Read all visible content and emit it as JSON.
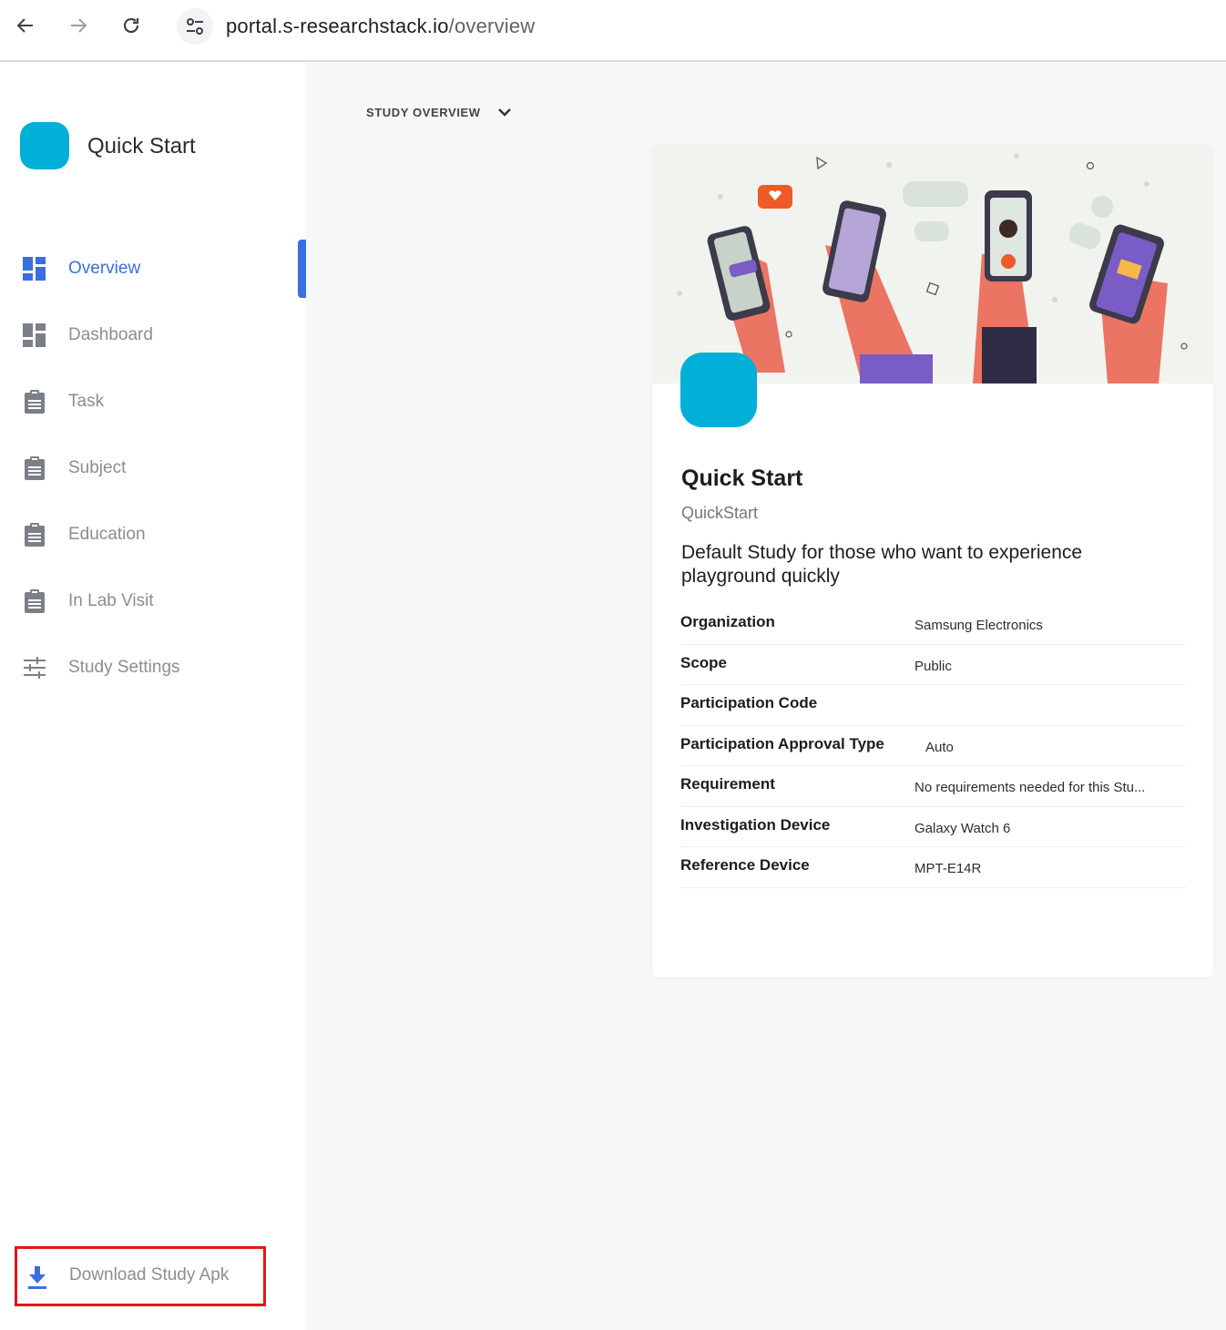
{
  "browser": {
    "url_host": "portal.s-researchstack.io",
    "url_path": "/overview"
  },
  "sidebar": {
    "study_name": "Quick Start",
    "items": [
      {
        "label": "Overview",
        "icon": "dashboard-tiles-icon",
        "active": true
      },
      {
        "label": "Dashboard",
        "icon": "dashboard-tiles-icon",
        "active": false
      },
      {
        "label": "Task",
        "icon": "clipboard-icon",
        "active": false
      },
      {
        "label": "Subject",
        "icon": "clipboard-icon",
        "active": false
      },
      {
        "label": "Education",
        "icon": "clipboard-icon",
        "active": false
      },
      {
        "label": "In Lab Visit",
        "icon": "clipboard-icon",
        "active": false
      },
      {
        "label": "Study Settings",
        "icon": "sliders-icon",
        "active": false
      }
    ],
    "download_label": "Download Study Apk"
  },
  "main": {
    "section_label": "STUDY OVERVIEW",
    "card": {
      "title": "Quick Start",
      "subtitle": "QuickStart",
      "description": "Default Study for those who want to experience playground quickly",
      "rows": [
        {
          "key": "Organization",
          "value": "Samsung Electronics"
        },
        {
          "key": "Scope",
          "value": "Public"
        },
        {
          "key": "Participation Code",
          "value": ""
        },
        {
          "key": "Participation Approval Type",
          "value": "Auto"
        },
        {
          "key": "Requirement",
          "value": "No requirements needed for this Stu..."
        },
        {
          "key": "Investigation Device",
          "value": "Galaxy Watch 6"
        },
        {
          "key": "Reference Device",
          "value": "MPT-E14R"
        }
      ]
    }
  },
  "colors": {
    "accent": "#3a6fe0",
    "study_logo": "#00b0d8",
    "highlight_border": "#e4141c"
  }
}
